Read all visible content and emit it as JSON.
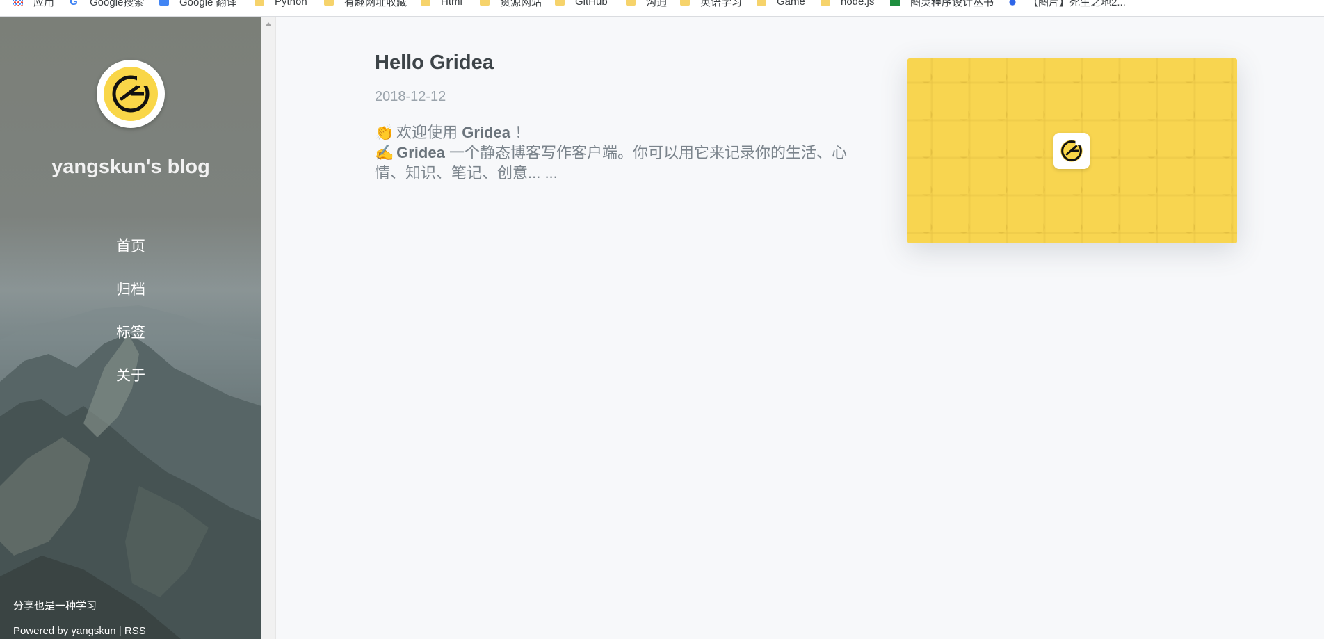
{
  "bookmarks": [
    {
      "label": "应用",
      "icon": "apps-icon"
    },
    {
      "label": "Google搜索",
      "icon": "google-icon"
    },
    {
      "label": "Google 翻译",
      "icon": "google-translate-icon"
    },
    {
      "label": "Python",
      "icon": "folder-icon"
    },
    {
      "label": "有趣网址收藏",
      "icon": "folder-icon"
    },
    {
      "label": "Html",
      "icon": "folder-icon"
    },
    {
      "label": "资源网站",
      "icon": "folder-icon"
    },
    {
      "label": "GitHub",
      "icon": "folder-icon"
    },
    {
      "label": "沟通",
      "icon": "folder-icon"
    },
    {
      "label": "英语学习",
      "icon": "folder-icon"
    },
    {
      "label": "Game",
      "icon": "folder-icon"
    },
    {
      "label": "node.js",
      "icon": "folder-icon"
    },
    {
      "label": "图灵程序设计丛书",
      "icon": "book-icon"
    },
    {
      "label": "【图片】死生之地2...",
      "icon": "baidu-icon"
    }
  ],
  "sidebar": {
    "blog_title": "yangskun's blog",
    "nav": [
      "首页",
      "归档",
      "标签",
      "关于"
    ],
    "motto": "分享也是一种学习",
    "powered_prefix": "Powered by",
    "powered_author": "yangskun",
    "separator": "|",
    "rss": "RSS"
  },
  "post": {
    "title": "Hello Gridea",
    "date": "2018-12-12",
    "line1_emoji": "👏",
    "line1_pre": "欢迎使用",
    "line1_bold": "Gridea",
    "line1_post": "！",
    "line2_emoji": "✍️",
    "line2_bold": "Gridea",
    "line2_rest": "一个静态博客写作客户端。你可以用它来记录你的生活、心情、知识、笔记、创意... ..."
  },
  "colors": {
    "brand_yellow": "#f8d550",
    "sidebar_text": "#ffffff",
    "title_text": "#3d4448",
    "muted_text": "#9aa3ab"
  }
}
